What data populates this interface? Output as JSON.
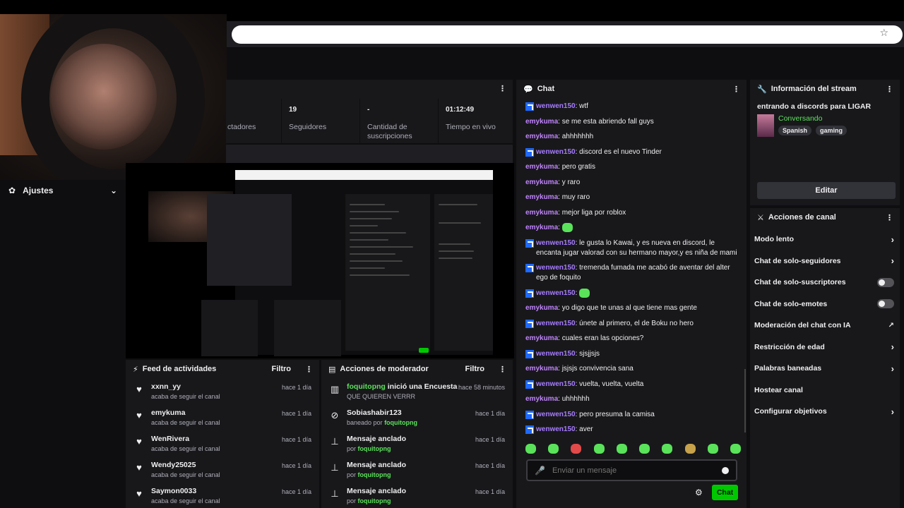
{
  "sidebar": {
    "settings_label": "Ajustes"
  },
  "stats": [
    {
      "value": "",
      "label": "ctadores"
    },
    {
      "value": "19",
      "label": "Seguidores"
    },
    {
      "value": "-",
      "label": "Cantidad de suscripciones"
    },
    {
      "value": "01:12:49",
      "label": "Tiempo en vivo"
    }
  ],
  "activity_feed": {
    "title": "Feed de actividades",
    "filter_label": "Filtro",
    "items": [
      {
        "name": "xxnn_yy",
        "desc": "acaba de seguir el canal",
        "time": "hace 1 día"
      },
      {
        "name": "emykuma",
        "desc": "acaba de seguir el canal",
        "time": "hace 1 día"
      },
      {
        "name": "WenRivera",
        "desc": "acaba de seguir el canal",
        "time": "hace 1 día"
      },
      {
        "name": "Wendy25025",
        "desc": "acaba de seguir el canal",
        "time": "hace 1 día"
      },
      {
        "name": "Saymon0033",
        "desc": "acaba de seguir el canal",
        "time": "hace 1 día"
      }
    ]
  },
  "mod_actions": {
    "title": "Acciones de moderador",
    "filter_label": "Filtro",
    "items": [
      {
        "actor": "foquitopng",
        "action": "inició una Encuesta",
        "sub": "QUE QUIEREN VERRR",
        "time": "hace 58 minutos",
        "icon": "poll-icon"
      },
      {
        "title": "Sobiashabir123",
        "sub_prefix": "baneado por",
        "sub_user": "foquitopng",
        "time": "hace 1 día",
        "icon": "ban-icon"
      },
      {
        "title": "Mensaje anclado",
        "sub_prefix": "por",
        "sub_user": "foquitopng",
        "time": "hace 1 día",
        "icon": "pin-icon"
      },
      {
        "title": "Mensaje anclado",
        "sub_prefix": "por",
        "sub_user": "foquitopng",
        "time": "hace 1 día",
        "icon": "pin-icon"
      },
      {
        "title": "Mensaje anclado",
        "sub_prefix": "por",
        "sub_user": "foquitopng",
        "time": "hace 1 día",
        "icon": "pin-icon"
      }
    ]
  },
  "chat": {
    "title": "Chat",
    "messages": [
      {
        "user": "wenwen150",
        "badge": true,
        "text": "wtf"
      },
      {
        "user": "emykuma",
        "badge": false,
        "text": "se me esta abriendo fall guys"
      },
      {
        "user": "emykuma",
        "badge": false,
        "text": "ahhhhhhh"
      },
      {
        "user": "wenwen150",
        "badge": true,
        "text": "discord es el nuevo Tinder"
      },
      {
        "user": "emykuma",
        "badge": false,
        "text": "pero gratis"
      },
      {
        "user": "emykuma",
        "badge": false,
        "text": "y raro"
      },
      {
        "user": "emykuma",
        "badge": false,
        "text": "muy raro"
      },
      {
        "user": "emykuma",
        "badge": false,
        "text": "mejor liga por roblox"
      },
      {
        "user": "emykuma",
        "badge": false,
        "text": "",
        "emote": true
      },
      {
        "user": "wenwen150",
        "badge": true,
        "text": "le gusta lo Kawai, y es nueva en discord, le encanta jugar valorad con su hermano mayor,y es niña de mami"
      },
      {
        "user": "wenwen150",
        "badge": true,
        "text": "tremenda fumada me acabó de aventar del alter ego de foquito"
      },
      {
        "user": "wenwen150",
        "badge": true,
        "text": "",
        "emote": true
      },
      {
        "user": "emykuma",
        "badge": false,
        "text": "yo digo que te unas al que tiene mas gente"
      },
      {
        "user": "wenwen150",
        "badge": true,
        "text": "únete al primero, el de Boku no hero"
      },
      {
        "user": "emykuma",
        "badge": false,
        "text": "cuales eran las opciones?"
      },
      {
        "user": "wenwen150",
        "badge": true,
        "text": "sjsjjsjs"
      },
      {
        "user": "emykuma",
        "badge": false,
        "text": "jsjsjs convivencia sana"
      },
      {
        "user": "wenwen150",
        "badge": true,
        "text": "vuelta, vuelta, vuelta"
      },
      {
        "user": "emykuma",
        "badge": false,
        "text": "uhhhhhh"
      },
      {
        "user": "wenwen150",
        "badge": true,
        "text": "pero presuma la camisa"
      },
      {
        "user": "wenwen150",
        "badge": true,
        "text": "aver"
      }
    ],
    "input_placeholder": "Enviar un mensaje",
    "send_label": "Chat"
  },
  "stream_info": {
    "header": "Información del stream",
    "title": "entrando a discords para LIGAR",
    "category": "Conversando",
    "tags": [
      "Spanish",
      "gaming"
    ],
    "edit_label": "Editar"
  },
  "channel_actions": {
    "header": "Acciones de canal",
    "items": [
      {
        "label": "Modo lento",
        "control": "chevron"
      },
      {
        "label": "Chat de solo-seguidores",
        "control": "chevron"
      },
      {
        "label": "Chat de solo-suscriptores",
        "control": "toggle",
        "on": false
      },
      {
        "label": "Chat de solo-emotes",
        "control": "toggle",
        "on": false
      },
      {
        "label": "Moderación del chat con IA",
        "control": "external"
      },
      {
        "label": "Restricción de edad",
        "control": "chevron"
      },
      {
        "label": "Palabras baneadas",
        "control": "chevron"
      },
      {
        "label": "Hostear canal",
        "control": "none"
      },
      {
        "label": "Configurar objetivos",
        "control": "chevron"
      }
    ]
  },
  "colors": {
    "accent_green": "#00c800",
    "badge_blue": "#1e69ff",
    "username_purple": "#c084fc",
    "panel_bg": "#18181b",
    "page_bg": "#0e0e10"
  }
}
